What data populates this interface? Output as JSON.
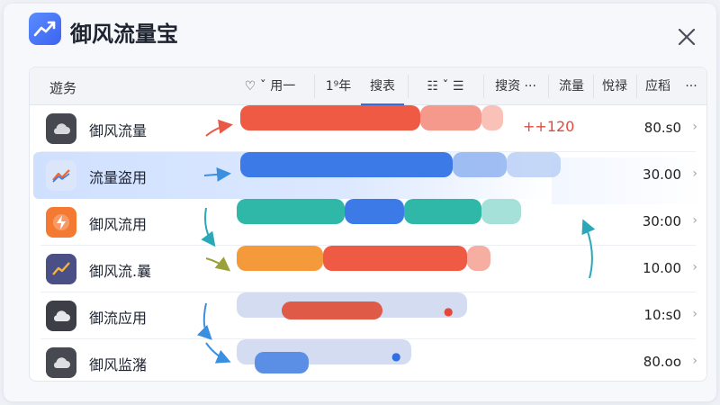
{
  "app": {
    "title": "御风流量宝",
    "logo_icon": "trend-chart-icon",
    "close_icon": "close-icon"
  },
  "toolbar": {
    "label": "遊务",
    "items": [
      "♡ ˇ 用一",
      "1⁹年",
      "搜表",
      "☷ ˇ ☰",
      "搜资 ···",
      "流量",
      "悅禄",
      "应稻",
      "···"
    ]
  },
  "rows": [
    {
      "label": "御风流量",
      "value": "80.s0",
      "icon": "cloud-icon",
      "icon_bg": "#45484f",
      "delta": "++120",
      "bar_color": "#ef5a45"
    },
    {
      "label": "流量盗用",
      "value": "30.00",
      "icon": "trend-chart-icon",
      "icon_bg": "#dbe6fb",
      "bar_color": "#3c7ae8"
    },
    {
      "label": "御风流用",
      "value": "30:00",
      "icon": "lightning-icon",
      "icon_bg": "#f47a33",
      "bar_color": "#2fb8a8"
    },
    {
      "label": "御风流.曩",
      "value": "10.00",
      "icon": "trend-chart-icon",
      "icon_bg": "#4a4f86",
      "bar_color": "#f59a3a"
    },
    {
      "label": "御流应用",
      "value": "10:s0",
      "icon": "cloud-icon",
      "icon_bg": "#3c3f46",
      "bar_color": "#c9d4ee"
    },
    {
      "label": "御风监潴",
      "value": "80.oo",
      "icon": "cloud-folder-icon",
      "icon_bg": "#46494f",
      "bar_color": "#c9d4ee"
    }
  ],
  "colors": {
    "accent": "#2f6fe4",
    "red": "#ef5a45",
    "blue": "#3c7ae8",
    "teal": "#2fb8a8",
    "orange": "#f59a3a"
  }
}
